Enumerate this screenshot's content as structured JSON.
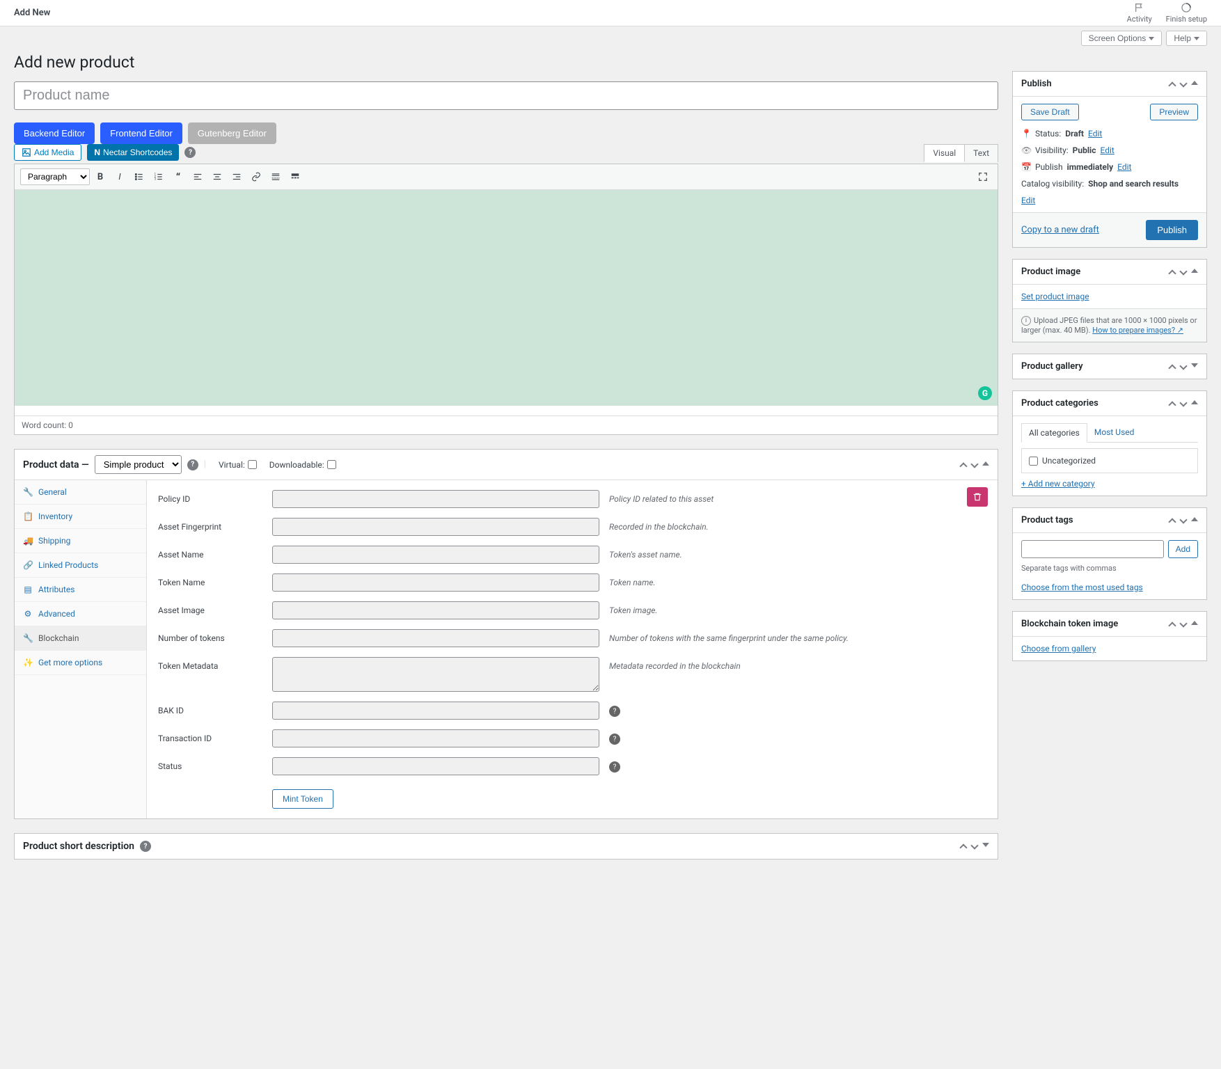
{
  "topbar": {
    "title": "Add New",
    "activity": "Activity",
    "finish_setup": "Finish setup"
  },
  "screen_meta": {
    "screen_options": "Screen Options",
    "help": "Help"
  },
  "page": {
    "heading": "Add new product",
    "product_name_placeholder": "Product name"
  },
  "editor_modes": {
    "backend": "Backend Editor",
    "frontend": "Frontend Editor",
    "gutenberg": "Gutenberg Editor"
  },
  "media": {
    "add_media": "Add Media",
    "nectar": "Nectar Shortcodes"
  },
  "editor_tabs": {
    "visual": "Visual",
    "text": "Text"
  },
  "tinymce": {
    "format_select": "Paragraph"
  },
  "word_count": "Word count: 0",
  "product_data": {
    "label": "Product data —",
    "type": "Simple product",
    "virtual": "Virtual:",
    "downloadable": "Downloadable:",
    "tabs": {
      "general": "General",
      "inventory": "Inventory",
      "shipping": "Shipping",
      "linked": "Linked Products",
      "attributes": "Attributes",
      "advanced": "Advanced",
      "blockchain": "Blockchain",
      "options": "Get more options"
    },
    "fields": {
      "policy_id": {
        "label": "Policy ID",
        "hint": "Policy ID related to this asset"
      },
      "fingerprint": {
        "label": "Asset Fingerprint",
        "hint": "Recorded in the blockchain."
      },
      "asset_name": {
        "label": "Asset Name",
        "hint": "Token's asset name."
      },
      "token_name": {
        "label": "Token Name",
        "hint": "Token name."
      },
      "asset_image": {
        "label": "Asset Image",
        "hint": "Token image."
      },
      "num_tokens": {
        "label": "Number of tokens",
        "hint": "Number of tokens with the same fingerprint under the same policy."
      },
      "metadata": {
        "label": "Token Metadata",
        "hint": "Metadata recorded in the blockchain"
      },
      "bak_id": {
        "label": "BAK ID"
      },
      "tx_id": {
        "label": "Transaction ID"
      },
      "status": {
        "label": "Status"
      }
    },
    "mint": "Mint Token"
  },
  "short_desc": {
    "title": "Product short description"
  },
  "publish": {
    "title": "Publish",
    "save_draft": "Save Draft",
    "preview": "Preview",
    "status_label": "Status:",
    "status_value": "Draft",
    "visibility_label": "Visibility:",
    "visibility_value": "Public",
    "publish_label": "Publish",
    "publish_value": "immediately",
    "catalog_label": "Catalog visibility:",
    "catalog_value": "Shop and search results",
    "edit": "Edit",
    "copy": "Copy to a new draft",
    "publish_btn": "Publish"
  },
  "product_image": {
    "title": "Product image",
    "set_link": "Set product image",
    "note1": "Upload JPEG files that are 1000 × 1000 pixels or larger (max. 40 MB). ",
    "note_link": "How to prepare images?"
  },
  "product_gallery": {
    "title": "Product gallery"
  },
  "product_categories": {
    "title": "Product categories",
    "all_tab": "All categories",
    "most_tab": "Most Used",
    "uncat": "Uncategorized",
    "add_new": "+ Add new category"
  },
  "product_tags": {
    "title": "Product tags",
    "add": "Add",
    "hint": "Separate tags with commas",
    "choose": "Choose from the most used tags"
  },
  "token_image": {
    "title": "Blockchain token image",
    "choose": "Choose from gallery"
  }
}
